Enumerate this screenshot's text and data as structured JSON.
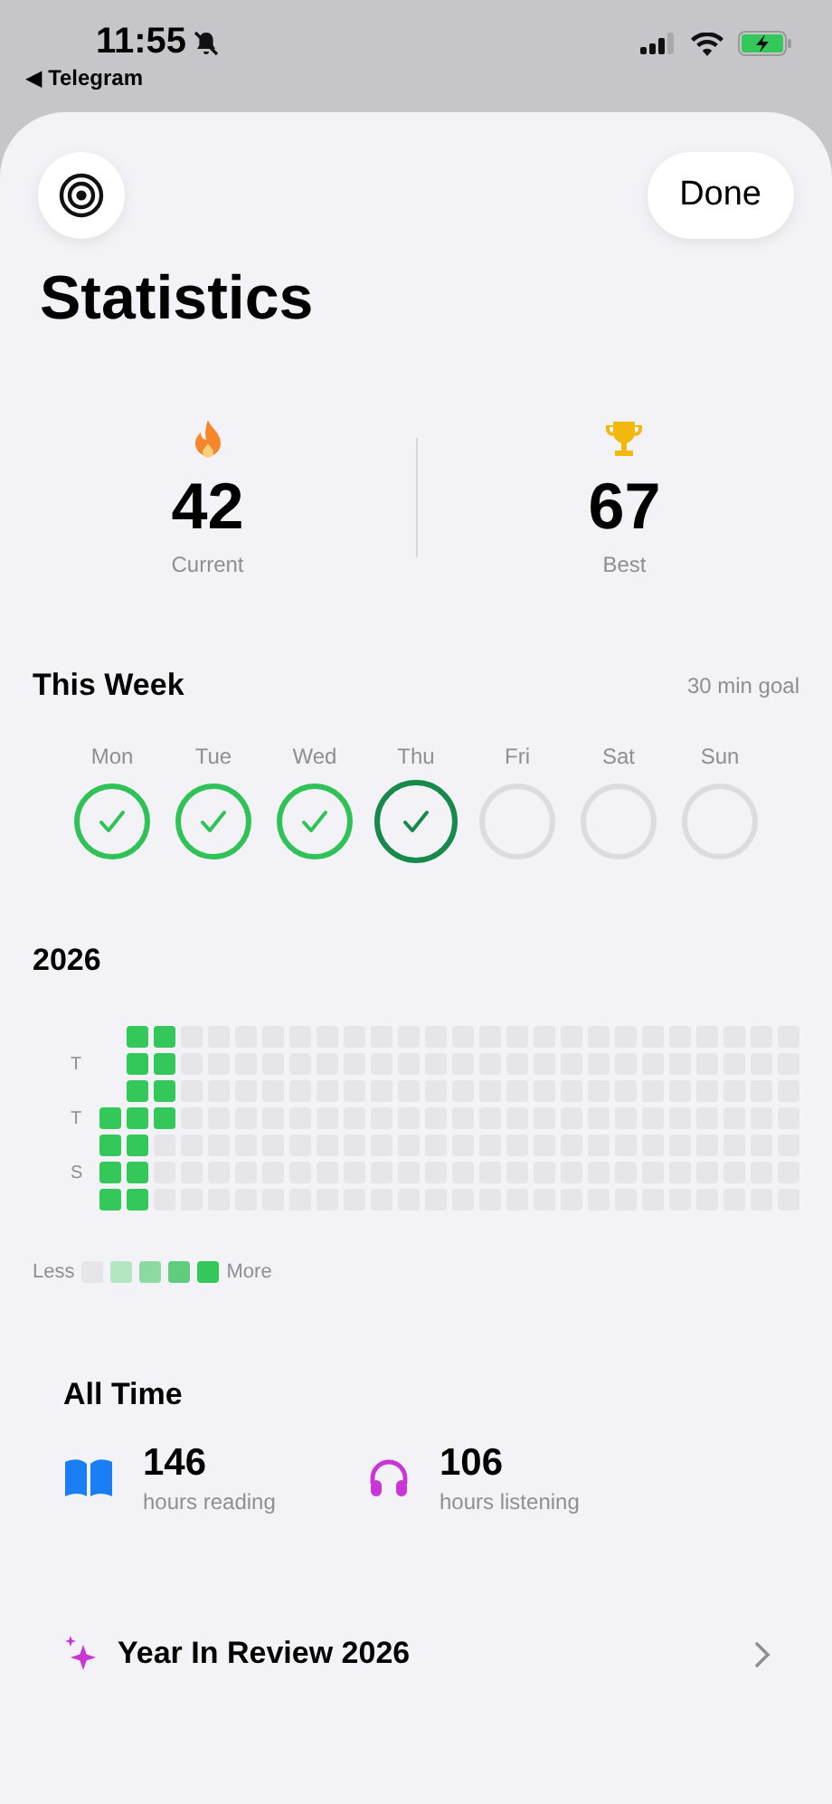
{
  "status_bar": {
    "time": "11:55",
    "back_app": "◀ Telegram",
    "muted": true
  },
  "header": {
    "done_button": "Done"
  },
  "title": "Statistics",
  "streaks": [
    {
      "kind": "current",
      "value": "42",
      "label": "Current"
    },
    {
      "kind": "best",
      "value": "67",
      "label": "Best"
    }
  ],
  "this_week": {
    "title": "This Week",
    "goal": "30 min goal",
    "days": [
      {
        "label": "Mon",
        "done": true,
        "selected": false
      },
      {
        "label": "Tue",
        "done": true,
        "selected": false
      },
      {
        "label": "Wed",
        "done": true,
        "selected": false
      },
      {
        "label": "Thu",
        "done": true,
        "selected": true
      },
      {
        "label": "Fri",
        "done": false,
        "selected": false
      },
      {
        "label": "Sat",
        "done": false,
        "selected": false
      },
      {
        "label": "Sun",
        "done": false,
        "selected": false
      }
    ]
  },
  "year": {
    "title": "2026",
    "rows": [
      {
        "cells": [
          {
            "kind": "blank"
          },
          {
            "kind": "done"
          },
          {
            "kind": "done"
          },
          {
            "kind": "empty"
          },
          {
            "kind": "empty"
          },
          {
            "kind": "empty"
          },
          {
            "kind": "empty"
          },
          {
            "kind": "empty"
          },
          {
            "kind": "empty"
          },
          {
            "kind": "empty"
          },
          {
            "kind": "empty"
          },
          {
            "kind": "empty"
          },
          {
            "kind": "empty"
          },
          {
            "kind": "empty"
          },
          {
            "kind": "empty"
          },
          {
            "kind": "empty"
          },
          {
            "kind": "empty"
          },
          {
            "kind": "empty"
          },
          {
            "kind": "empty"
          },
          {
            "kind": "empty"
          },
          {
            "kind": "empty"
          },
          {
            "kind": "empty"
          },
          {
            "kind": "empty"
          },
          {
            "kind": "empty"
          },
          {
            "kind": "empty"
          },
          {
            "kind": "empty"
          }
        ]
      },
      {
        "label": "T",
        "cells": [
          {
            "kind": "blank"
          },
          {
            "kind": "done"
          },
          {
            "kind": "done"
          },
          {
            "kind": "empty"
          },
          {
            "kind": "empty"
          },
          {
            "kind": "empty"
          },
          {
            "kind": "empty"
          },
          {
            "kind": "empty"
          },
          {
            "kind": "empty"
          },
          {
            "kind": "empty"
          },
          {
            "kind": "empty"
          },
          {
            "kind": "empty"
          },
          {
            "kind": "empty"
          },
          {
            "kind": "empty"
          },
          {
            "kind": "empty"
          },
          {
            "kind": "empty"
          },
          {
            "kind": "empty"
          },
          {
            "kind": "empty"
          },
          {
            "kind": "empty"
          },
          {
            "kind": "empty"
          },
          {
            "kind": "empty"
          },
          {
            "kind": "empty"
          },
          {
            "kind": "empty"
          },
          {
            "kind": "empty"
          },
          {
            "kind": "empty"
          },
          {
            "kind": "empty"
          }
        ]
      },
      {
        "cells": [
          {
            "kind": "blank"
          },
          {
            "kind": "done"
          },
          {
            "kind": "done"
          },
          {
            "kind": "empty"
          },
          {
            "kind": "empty"
          },
          {
            "kind": "empty"
          },
          {
            "kind": "empty"
          },
          {
            "kind": "empty"
          },
          {
            "kind": "empty"
          },
          {
            "kind": "empty"
          },
          {
            "kind": "empty"
          },
          {
            "kind": "empty"
          },
          {
            "kind": "empty"
          },
          {
            "kind": "empty"
          },
          {
            "kind": "empty"
          },
          {
            "kind": "empty"
          },
          {
            "kind": "empty"
          },
          {
            "kind": "empty"
          },
          {
            "kind": "empty"
          },
          {
            "kind": "empty"
          },
          {
            "kind": "empty"
          },
          {
            "kind": "empty"
          },
          {
            "kind": "empty"
          },
          {
            "kind": "empty"
          },
          {
            "kind": "empty"
          },
          {
            "kind": "empty"
          }
        ]
      },
      {
        "label": "T",
        "cells": [
          {
            "kind": "done"
          },
          {
            "kind": "done"
          },
          {
            "kind": "done"
          },
          {
            "kind": "empty"
          },
          {
            "kind": "empty"
          },
          {
            "kind": "empty"
          },
          {
            "kind": "empty"
          },
          {
            "kind": "empty"
          },
          {
            "kind": "empty"
          },
          {
            "kind": "empty"
          },
          {
            "kind": "empty"
          },
          {
            "kind": "empty"
          },
          {
            "kind": "empty"
          },
          {
            "kind": "empty"
          },
          {
            "kind": "empty"
          },
          {
            "kind": "empty"
          },
          {
            "kind": "empty"
          },
          {
            "kind": "empty"
          },
          {
            "kind": "empty"
          },
          {
            "kind": "empty"
          },
          {
            "kind": "empty"
          },
          {
            "kind": "empty"
          },
          {
            "kind": "empty"
          },
          {
            "kind": "empty"
          },
          {
            "kind": "empty"
          },
          {
            "kind": "empty"
          }
        ]
      },
      {
        "cells": [
          {
            "kind": "done"
          },
          {
            "kind": "done"
          },
          {
            "kind": "empty"
          },
          {
            "kind": "empty"
          },
          {
            "kind": "empty"
          },
          {
            "kind": "empty"
          },
          {
            "kind": "empty"
          },
          {
            "kind": "empty"
          },
          {
            "kind": "empty"
          },
          {
            "kind": "empty"
          },
          {
            "kind": "empty"
          },
          {
            "kind": "empty"
          },
          {
            "kind": "empty"
          },
          {
            "kind": "empty"
          },
          {
            "kind": "empty"
          },
          {
            "kind": "empty"
          },
          {
            "kind": "empty"
          },
          {
            "kind": "empty"
          },
          {
            "kind": "empty"
          },
          {
            "kind": "empty"
          },
          {
            "kind": "empty"
          },
          {
            "kind": "empty"
          },
          {
            "kind": "empty"
          },
          {
            "kind": "empty"
          },
          {
            "kind": "empty"
          },
          {
            "kind": "empty"
          }
        ]
      },
      {
        "label": "S",
        "cells": [
          {
            "kind": "done"
          },
          {
            "kind": "done"
          },
          {
            "kind": "empty"
          },
          {
            "kind": "empty"
          },
          {
            "kind": "empty"
          },
          {
            "kind": "empty"
          },
          {
            "kind": "empty"
          },
          {
            "kind": "empty"
          },
          {
            "kind": "empty"
          },
          {
            "kind": "empty"
          },
          {
            "kind": "empty"
          },
          {
            "kind": "empty"
          },
          {
            "kind": "empty"
          },
          {
            "kind": "empty"
          },
          {
            "kind": "empty"
          },
          {
            "kind": "empty"
          },
          {
            "kind": "empty"
          },
          {
            "kind": "empty"
          },
          {
            "kind": "empty"
          },
          {
            "kind": "empty"
          },
          {
            "kind": "empty"
          },
          {
            "kind": "empty"
          },
          {
            "kind": "empty"
          },
          {
            "kind": "empty"
          },
          {
            "kind": "empty"
          },
          {
            "kind": "empty"
          }
        ]
      },
      {
        "cells": [
          {
            "kind": "done"
          },
          {
            "kind": "done"
          },
          {
            "kind": "empty"
          },
          {
            "kind": "empty"
          },
          {
            "kind": "empty"
          },
          {
            "kind": "empty"
          },
          {
            "kind": "empty"
          },
          {
            "kind": "empty"
          },
          {
            "kind": "empty"
          },
          {
            "kind": "empty"
          },
          {
            "kind": "empty"
          },
          {
            "kind": "empty"
          },
          {
            "kind": "empty"
          },
          {
            "kind": "empty"
          },
          {
            "kind": "empty"
          },
          {
            "kind": "empty"
          },
          {
            "kind": "empty"
          },
          {
            "kind": "empty"
          },
          {
            "kind": "empty"
          },
          {
            "kind": "empty"
          },
          {
            "kind": "empty"
          },
          {
            "kind": "empty"
          },
          {
            "kind": "empty"
          },
          {
            "kind": "empty"
          },
          {
            "kind": "empty"
          },
          {
            "kind": "empty"
          }
        ]
      }
    ],
    "legend": {
      "less": "Less",
      "more": "More",
      "steps": [
        {
          "color": "#e5e5ea"
        },
        {
          "color": "#b5e6c2"
        },
        {
          "color": "#8dd9a2"
        },
        {
          "color": "#5fcd7d"
        },
        {
          "color": "#34c759"
        }
      ]
    }
  },
  "all_time": {
    "title": "All Time",
    "stats": [
      {
        "kind": "reading",
        "value": "146",
        "label": "hours reading"
      },
      {
        "kind": "listening",
        "value": "106",
        "label": "hours listening"
      }
    ]
  },
  "year_review": {
    "label": "Year In Review 2026"
  }
}
